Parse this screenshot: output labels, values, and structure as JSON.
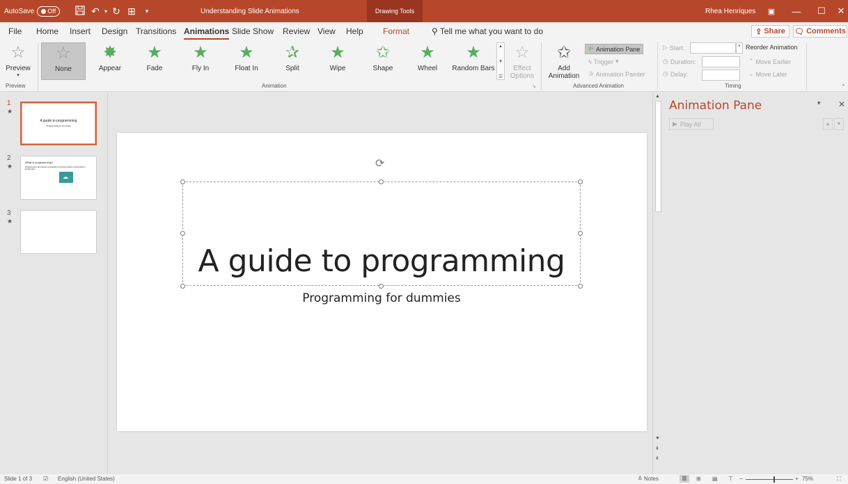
{
  "titlebar": {
    "autosave_label": "AutoSave",
    "autosave_state": "Off",
    "doc_title": "Understanding Slide Animations",
    "context_tab": "Drawing Tools",
    "user_name": "Rhea Henriques"
  },
  "menu": {
    "items": [
      "File",
      "Home",
      "Insert",
      "Design",
      "Transitions",
      "Animations",
      "Slide Show",
      "Review",
      "View",
      "Help",
      "Format"
    ],
    "active": "Animations",
    "tell_me": "Tell me what you want to do",
    "share": "Share",
    "comments": "Comments"
  },
  "ribbon": {
    "preview": "Preview",
    "preview_group": "Preview",
    "animations": [
      {
        "label": "None"
      },
      {
        "label": "Appear"
      },
      {
        "label": "Fade"
      },
      {
        "label": "Fly In"
      },
      {
        "label": "Float In"
      },
      {
        "label": "Split"
      },
      {
        "label": "Wipe"
      },
      {
        "label": "Shape"
      },
      {
        "label": "Wheel"
      },
      {
        "label": "Random Bars"
      }
    ],
    "effect_options": "Effect",
    "effect_options_2": "Options",
    "animation_group": "Animation",
    "add_animation": "Add",
    "add_animation_2": "Animation",
    "animation_pane": "Animation Pane",
    "trigger": "Trigger",
    "animation_painter": "Animation Painter",
    "advanced_group": "Advanced Animation",
    "start": "Start:",
    "duration": "Duration:",
    "delay": "Delay:",
    "reorder": "Reorder Animation",
    "move_earlier": "Move Earlier",
    "move_later": "Move Later",
    "timing_group": "Timing"
  },
  "thumbnails": [
    {
      "num": "1",
      "title": "A guide to programming",
      "subtitle": "Programming for dummies"
    },
    {
      "num": "2",
      "title": "What is programming?",
      "bullet": "Programming is the process of designing a computer program to accomplish a specific task."
    },
    {
      "num": "3"
    }
  ],
  "slide": {
    "title": "A guide to programming",
    "subtitle": "Programming for dummies"
  },
  "animation_pane": {
    "title": "Animation Pane",
    "play_all": "Play All"
  },
  "statusbar": {
    "slide_info": "Slide 1 of 3",
    "language": "English (United States)",
    "notes": "Notes",
    "zoom": "75%"
  }
}
